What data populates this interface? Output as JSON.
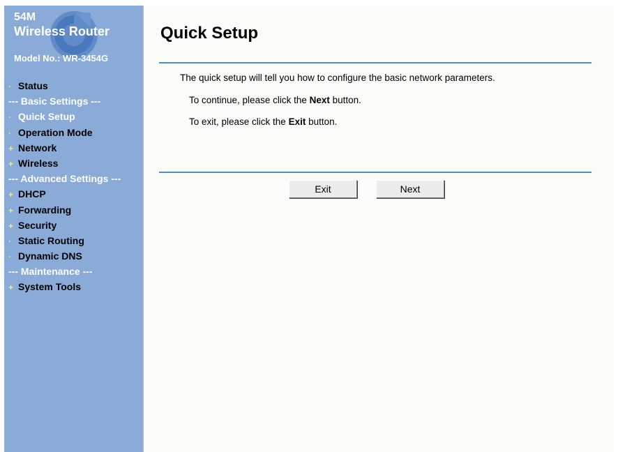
{
  "sidebar": {
    "brand_line1": "54M",
    "brand_line2": "Wireless Router",
    "model": "Model No.: WR-3454G",
    "items": [
      {
        "label": "Status",
        "bullet": "·",
        "kind": "item"
      },
      {
        "label": "--- Basic Settings ---",
        "bullet": "",
        "kind": "section"
      },
      {
        "label": "Quick Setup",
        "bullet": "·",
        "kind": "active"
      },
      {
        "label": "Operation Mode",
        "bullet": "·",
        "kind": "item"
      },
      {
        "label": "Network",
        "bullet": "+",
        "kind": "item"
      },
      {
        "label": "Wireless",
        "bullet": "+",
        "kind": "item"
      },
      {
        "label": "--- Advanced Settings ---",
        "bullet": "",
        "kind": "section"
      },
      {
        "label": "DHCP",
        "bullet": "+",
        "kind": "item"
      },
      {
        "label": "Forwarding",
        "bullet": "+",
        "kind": "item"
      },
      {
        "label": "Security",
        "bullet": "+",
        "kind": "item"
      },
      {
        "label": "Static Routing",
        "bullet": "·",
        "kind": "item"
      },
      {
        "label": "Dynamic DNS",
        "bullet": "·",
        "kind": "item"
      },
      {
        "label": "--- Maintenance ---",
        "bullet": "",
        "kind": "section"
      },
      {
        "label": "System Tools",
        "bullet": "+",
        "kind": "item"
      }
    ]
  },
  "main": {
    "title": "Quick Setup",
    "intro": "The quick setup will tell you how to configure the basic network parameters.",
    "continue_prefix": "To continue, please click the ",
    "continue_bold": "Next",
    "continue_suffix": " button.",
    "exit_prefix": "To exit, please click the ",
    "exit_bold": "Exit",
    "exit_suffix": " button.",
    "exit_button": "Exit",
    "next_button": "Next"
  },
  "colors": {
    "sidebar_bg": "#8aaad8",
    "rule": "#4c8ec8",
    "bullet": "#ffe96b"
  }
}
